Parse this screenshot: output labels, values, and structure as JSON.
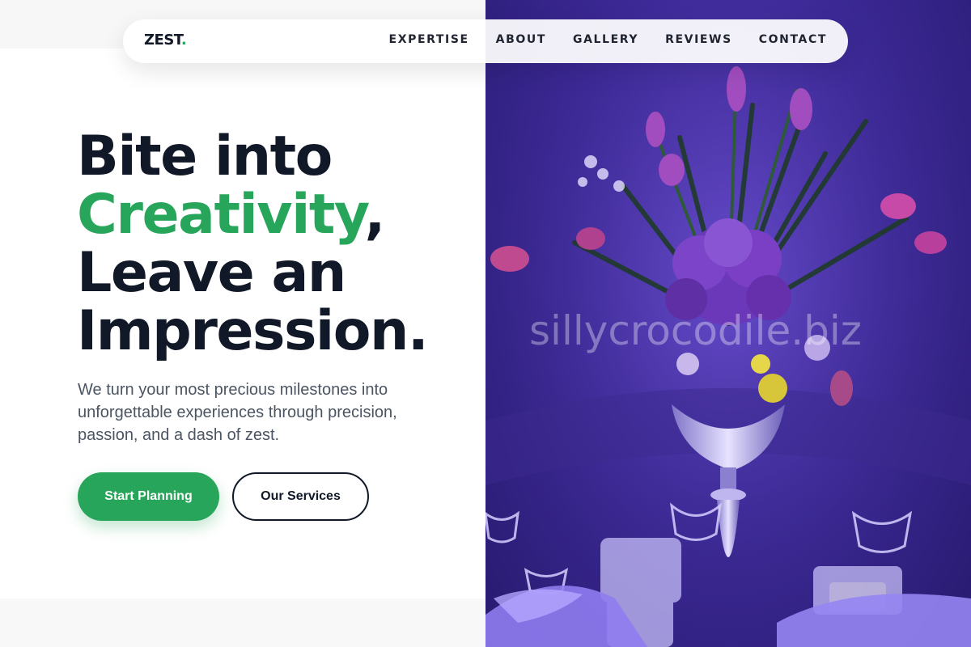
{
  "nav": {
    "logo_text": "ZEST",
    "logo_dot": ".",
    "links": [
      {
        "label": "EXPERTISE"
      },
      {
        "label": "ABOUT"
      },
      {
        "label": "GALLERY"
      },
      {
        "label": "REVIEWS"
      },
      {
        "label": "CONTACT"
      }
    ]
  },
  "hero": {
    "headline_line1": "Bite into",
    "headline_highlight": "Creativity",
    "headline_comma": ",",
    "headline_line3": "Leave an",
    "headline_line4": "Impression.",
    "subtext": "We turn your most precious milestones into unforgettable experiences through precision, passion, and a dash of zest.",
    "primary_button": "Start Planning",
    "secondary_button": "Our Services"
  },
  "image": {
    "watermark": "sillycrocodile.biz"
  },
  "colors": {
    "accent": "#27a55a",
    "text_dark": "#111827",
    "text_muted": "#4b5563",
    "photo_tone": "#4a32b0"
  }
}
